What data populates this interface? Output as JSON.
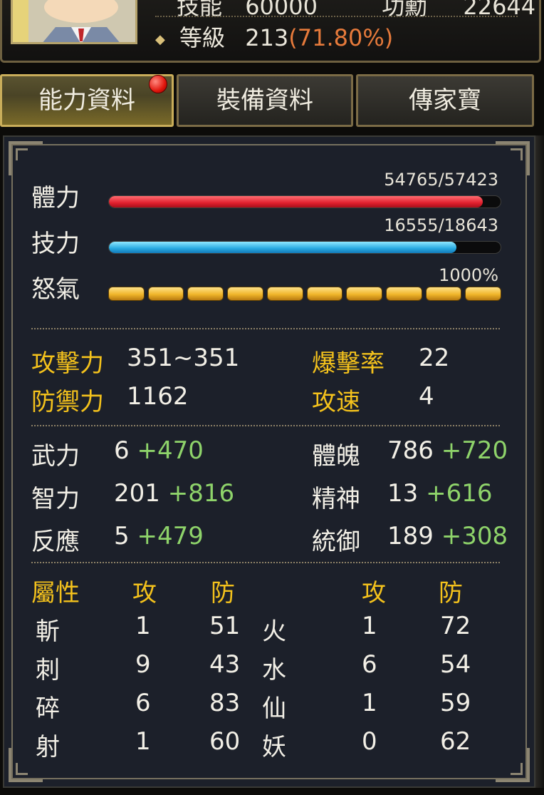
{
  "header": {
    "top_stat_label_1": "技能",
    "top_stat_value_1": "60000",
    "top_stat_label_2": "功勳",
    "top_stat_value_2": "22644",
    "level_label": "等級",
    "level_value": "213",
    "level_percent": "(71.80%)"
  },
  "tabs": [
    {
      "label": "能力資料",
      "active": true,
      "badge": true
    },
    {
      "label": "裝備資料",
      "active": false
    },
    {
      "label": "傳家寶",
      "active": false
    }
  ],
  "bars": {
    "hp": {
      "label": "體力",
      "value": "54765/57423",
      "fraction": 0.954
    },
    "mp": {
      "label": "技力",
      "value": "16555/18643",
      "fraction": 0.888
    },
    "rage": {
      "label": "怒氣",
      "value": "1000%",
      "segments": 10
    }
  },
  "combat": {
    "attack": {
      "label": "攻擊力",
      "value": "351~351"
    },
    "crit": {
      "label": "爆擊率",
      "value": "22"
    },
    "defense": {
      "label": "防禦力",
      "value": "1162"
    },
    "speed": {
      "label": "攻速",
      "value": "4"
    }
  },
  "attributes": [
    {
      "label": "武力",
      "base": "6",
      "bonus": "+470"
    },
    {
      "label": "體魄",
      "base": "786",
      "bonus": "+720"
    },
    {
      "label": "智力",
      "base": "201",
      "bonus": "+816"
    },
    {
      "label": "精神",
      "base": "13",
      "bonus": "+616"
    },
    {
      "label": "反應",
      "base": "5",
      "bonus": "+479"
    },
    {
      "label": "統御",
      "base": "189",
      "bonus": "+308"
    }
  ],
  "elements": {
    "header": {
      "title": "屬性",
      "atk": "攻",
      "def": "防",
      "atk2": "攻",
      "def2": "防"
    },
    "rows": [
      {
        "n1": "斬",
        "a1": "1",
        "d1": "51",
        "n2": "火",
        "a2": "1",
        "d2": "72"
      },
      {
        "n1": "刺",
        "a1": "9",
        "d1": "43",
        "n2": "水",
        "a2": "6",
        "d2": "54"
      },
      {
        "n1": "碎",
        "a1": "6",
        "d1": "83",
        "n2": "仙",
        "a2": "1",
        "d2": "59"
      },
      {
        "n1": "射",
        "a1": "1",
        "d1": "60",
        "n2": "妖",
        "a2": "0",
        "d2": "62"
      }
    ]
  },
  "colors": {
    "gold_label": "#f4c21c",
    "bonus_green": "#8ed36a",
    "level_percent": "#e67a3b",
    "hp_bar": "#e0202e",
    "mp_bar": "#26a9e0",
    "rage_bar": "#f0b52a"
  }
}
